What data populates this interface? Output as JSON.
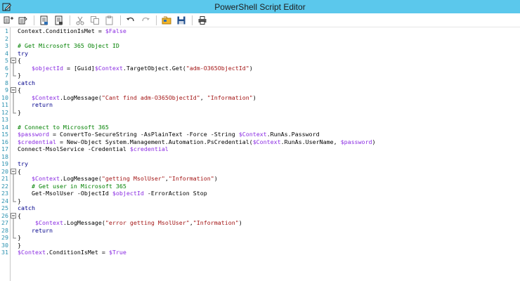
{
  "window": {
    "title": "PowerShell Script Editor",
    "icon": "edit-pencil-icon",
    "colors": {
      "titlebar": "#5bc8ec",
      "line_number": "#2b91af",
      "comment": "#008000",
      "keyword": "#00008b",
      "variable": "#8a2be2",
      "string": "#a31515"
    }
  },
  "toolbar": {
    "buttons": [
      {
        "name": "new-script",
        "icon": "new-script-icon"
      },
      {
        "name": "open-script",
        "icon": "open-script-icon"
      },
      {
        "name": "save",
        "icon": "save-doc-icon"
      },
      {
        "name": "save-as",
        "icon": "save-as-doc-icon"
      },
      {
        "name": "cut",
        "icon": "cut-icon"
      },
      {
        "name": "copy",
        "icon": "copy-icon"
      },
      {
        "name": "paste",
        "icon": "paste-icon"
      },
      {
        "name": "undo",
        "icon": "undo-icon"
      },
      {
        "name": "redo",
        "icon": "redo-icon"
      },
      {
        "name": "insert-variable",
        "icon": "insert-variable-icon"
      },
      {
        "name": "save-disk",
        "icon": "floppy-disk-icon"
      },
      {
        "name": "print",
        "icon": "print-icon"
      }
    ]
  },
  "editor": {
    "lines": [
      {
        "n": "1",
        "fold": "",
        "tokens": [
          [
            "plain",
            "Context.ConditionIsMet = "
          ],
          [
            "var",
            "$False"
          ]
        ]
      },
      {
        "n": "2",
        "fold": "",
        "tokens": []
      },
      {
        "n": "3",
        "fold": "",
        "tokens": [
          [
            "comment",
            "# Get Microsoft 365 Object ID"
          ]
        ]
      },
      {
        "n": "4",
        "fold": "",
        "tokens": [
          [
            "kw",
            "try"
          ]
        ]
      },
      {
        "n": "5",
        "fold": "open",
        "tokens": [
          [
            "plain",
            "{"
          ]
        ]
      },
      {
        "n": "6",
        "fold": "mid",
        "tokens": [
          [
            "plain",
            "    "
          ],
          [
            "var",
            "$objectId"
          ],
          [
            "plain",
            " = [Guid]"
          ],
          [
            "var",
            "$Context"
          ],
          [
            "plain",
            ".TargetObject.Get("
          ],
          [
            "str",
            "\"adm-O365ObjectId\""
          ],
          [
            "plain",
            ")"
          ]
        ]
      },
      {
        "n": "7",
        "fold": "close",
        "tokens": [
          [
            "plain",
            "}"
          ]
        ]
      },
      {
        "n": "8",
        "fold": "",
        "tokens": [
          [
            "kw",
            "catch"
          ]
        ]
      },
      {
        "n": "9",
        "fold": "open",
        "tokens": [
          [
            "plain",
            "{"
          ]
        ]
      },
      {
        "n": "10",
        "fold": "mid",
        "tokens": [
          [
            "plain",
            "    "
          ],
          [
            "var",
            "$Context"
          ],
          [
            "plain",
            ".LogMessage("
          ],
          [
            "str",
            "\"Cant find adm-O365ObjectId\""
          ],
          [
            "plain",
            ", "
          ],
          [
            "str",
            "\"Information\""
          ],
          [
            "plain",
            ")"
          ]
        ]
      },
      {
        "n": "11",
        "fold": "mid",
        "tokens": [
          [
            "plain",
            "    "
          ],
          [
            "kw",
            "return"
          ]
        ]
      },
      {
        "n": "12",
        "fold": "close",
        "tokens": [
          [
            "plain",
            "}"
          ]
        ]
      },
      {
        "n": "13",
        "fold": "",
        "tokens": []
      },
      {
        "n": "14",
        "fold": "",
        "tokens": [
          [
            "comment",
            "# Connect to Microsoft 365"
          ]
        ]
      },
      {
        "n": "15",
        "fold": "",
        "tokens": [
          [
            "var",
            "$password"
          ],
          [
            "plain",
            " = ConvertTo-SecureString -AsPlainText -Force -String "
          ],
          [
            "var",
            "$Context"
          ],
          [
            "plain",
            ".RunAs.Password"
          ]
        ]
      },
      {
        "n": "16",
        "fold": "",
        "tokens": [
          [
            "var",
            "$credential"
          ],
          [
            "plain",
            " = New-Object System.Management.Automation.PsCredential("
          ],
          [
            "var",
            "$Context"
          ],
          [
            "plain",
            ".RunAs.UserName, "
          ],
          [
            "var",
            "$password"
          ],
          [
            "plain",
            ")"
          ]
        ]
      },
      {
        "n": "17",
        "fold": "",
        "tokens": [
          [
            "plain",
            "Connect-MsolService -Credential "
          ],
          [
            "var",
            "$credential"
          ]
        ]
      },
      {
        "n": "18",
        "fold": "",
        "tokens": []
      },
      {
        "n": "19",
        "fold": "",
        "tokens": [
          [
            "kw",
            "try"
          ]
        ]
      },
      {
        "n": "20",
        "fold": "open",
        "tokens": [
          [
            "plain",
            "{"
          ]
        ]
      },
      {
        "n": "21",
        "fold": "mid",
        "tokens": [
          [
            "plain",
            "    "
          ],
          [
            "var",
            "$Context"
          ],
          [
            "plain",
            ".LogMessage("
          ],
          [
            "str",
            "\"getting MsolUser\""
          ],
          [
            "plain",
            ","
          ],
          [
            "str",
            "\"Information\""
          ],
          [
            "plain",
            ")"
          ]
        ]
      },
      {
        "n": "22",
        "fold": "mid",
        "tokens": [
          [
            "plain",
            "    "
          ],
          [
            "comment",
            "# Get user in Microsoft 365"
          ]
        ]
      },
      {
        "n": "23",
        "fold": "mid",
        "tokens": [
          [
            "plain",
            "    Get-MsolUser -ObjectId "
          ],
          [
            "var",
            "$objectId"
          ],
          [
            "plain",
            " -ErrorAction Stop"
          ]
        ]
      },
      {
        "n": "24",
        "fold": "close",
        "tokens": [
          [
            "plain",
            "}"
          ]
        ]
      },
      {
        "n": "25",
        "fold": "",
        "tokens": [
          [
            "kw",
            "catch"
          ]
        ]
      },
      {
        "n": "26",
        "fold": "open",
        "tokens": [
          [
            "plain",
            "{"
          ]
        ]
      },
      {
        "n": "27",
        "fold": "mid",
        "tokens": [
          [
            "plain",
            "     "
          ],
          [
            "var",
            "$Context"
          ],
          [
            "plain",
            ".LogMessage("
          ],
          [
            "str",
            "\"error getting MsolUser\""
          ],
          [
            "plain",
            ","
          ],
          [
            "str",
            "\"Information\""
          ],
          [
            "plain",
            ")"
          ]
        ]
      },
      {
        "n": "28",
        "fold": "mid",
        "tokens": [
          [
            "plain",
            "    "
          ],
          [
            "kw",
            "return"
          ]
        ]
      },
      {
        "n": "29",
        "fold": "close",
        "tokens": [
          [
            "plain",
            "}"
          ]
        ]
      },
      {
        "n": "30",
        "fold": "",
        "tokens": [
          [
            "plain",
            "}"
          ]
        ]
      },
      {
        "n": "31",
        "fold": "",
        "tokens": [
          [
            "var",
            "$Context"
          ],
          [
            "plain",
            ".ConditionIsMet = "
          ],
          [
            "var",
            "$True"
          ]
        ]
      }
    ]
  }
}
